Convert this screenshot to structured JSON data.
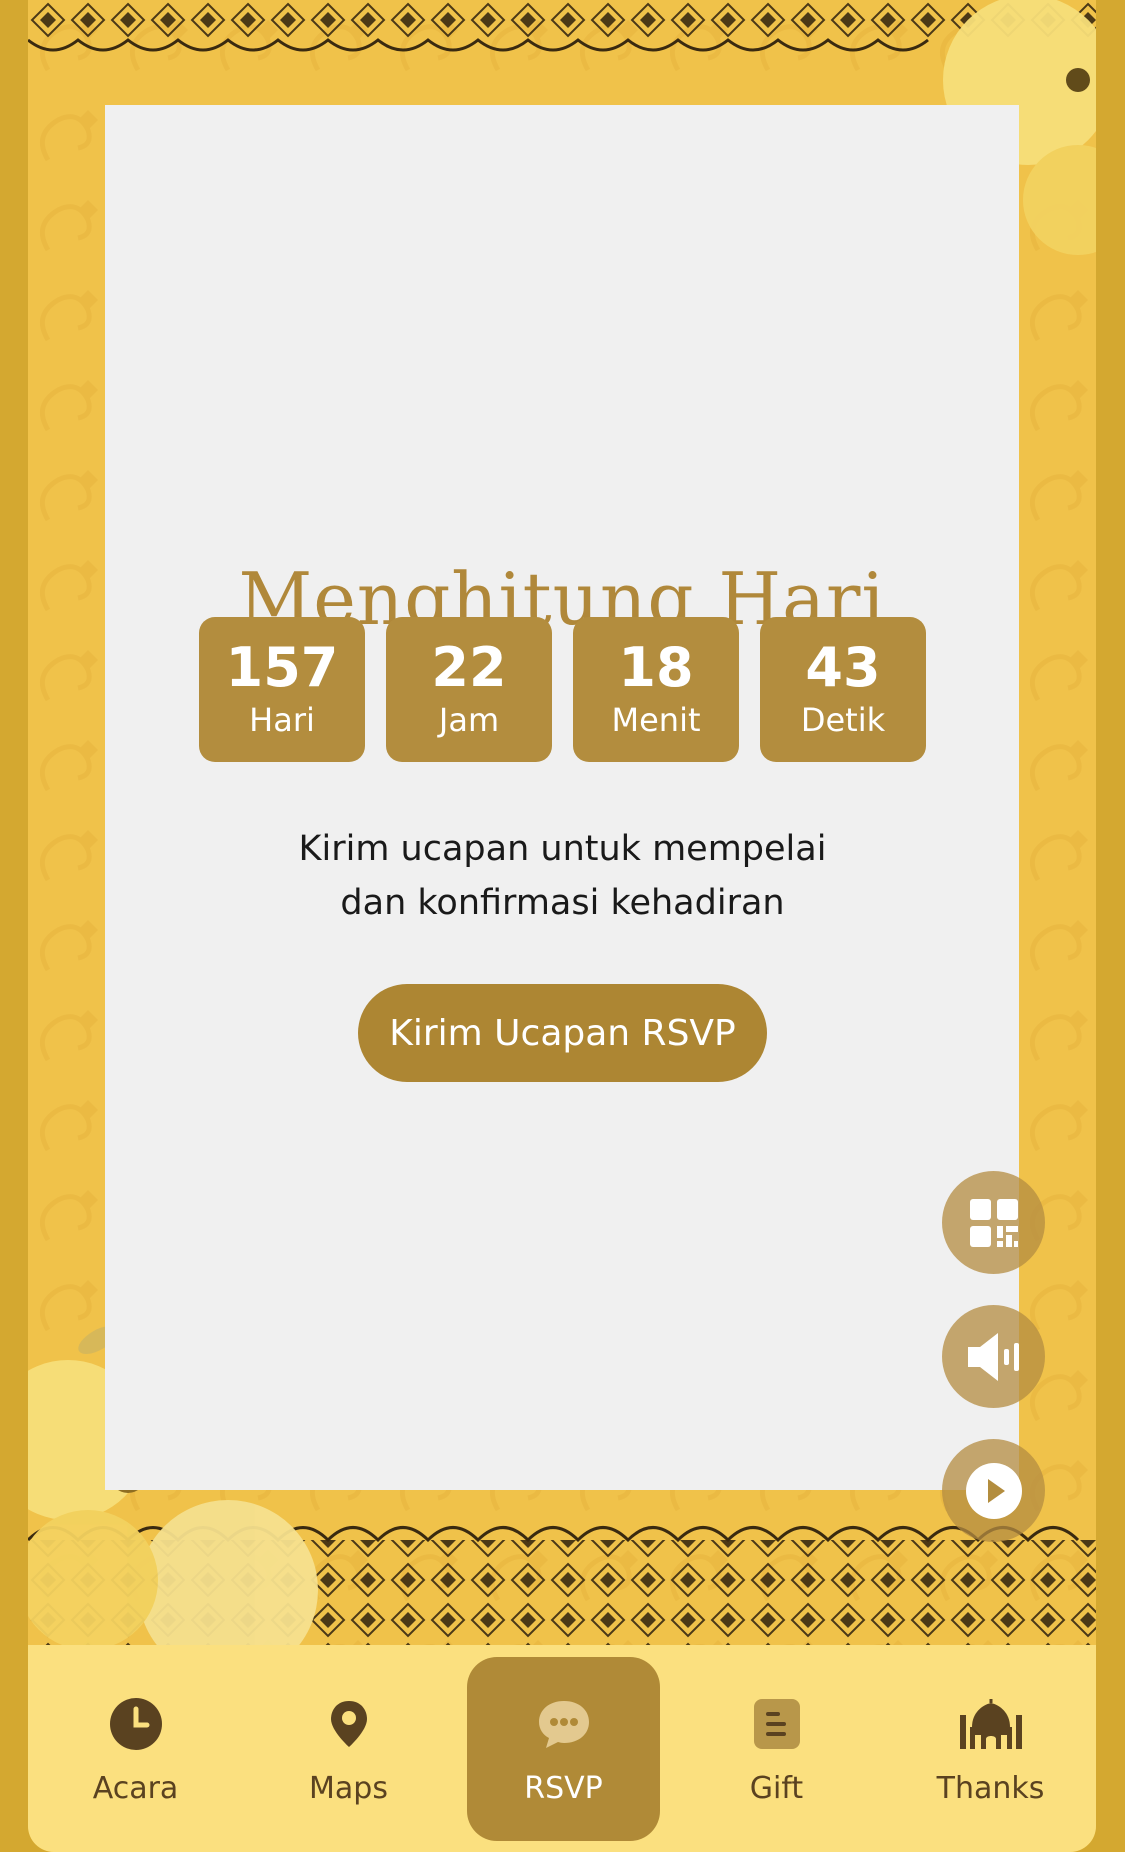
{
  "countdown": {
    "title": "Menghitung Hari",
    "units": [
      {
        "value": "157",
        "label": "Hari"
      },
      {
        "value": "22",
        "label": "Jam"
      },
      {
        "value": "18",
        "label": "Menit"
      },
      {
        "value": "43",
        "label": "Detik"
      }
    ]
  },
  "message": {
    "line1": "Kirim ucapan untuk mempelai",
    "line2": "dan konfirmasi kehadiran"
  },
  "rsvp_button_label": "Kirim Ucapan RSVP",
  "floating_buttons": [
    {
      "icon": "qr-code-icon"
    },
    {
      "icon": "speaker-icon"
    },
    {
      "icon": "play-icon"
    }
  ],
  "nav": {
    "items": [
      {
        "label": "Acara",
        "icon": "clock-icon"
      },
      {
        "label": "Maps",
        "icon": "map-pin-icon"
      },
      {
        "label": "RSVP",
        "icon": "chat-bubble-icon",
        "active": true
      },
      {
        "label": "Gift",
        "icon": "gift-icon"
      },
      {
        "label": "Thanks",
        "icon": "mosque-icon"
      }
    ]
  },
  "colors": {
    "accent": "#b38d3e",
    "frame": "#f0c24a",
    "nav_bg": "#fbe07f",
    "card_bg": "#f0f0f0"
  }
}
